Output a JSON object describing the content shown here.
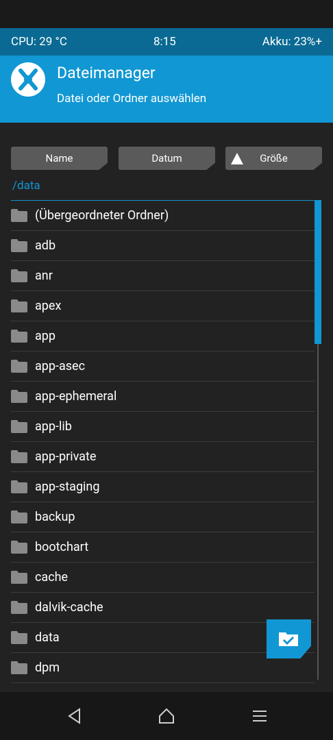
{
  "status": {
    "cpu": "CPU: 29 °C",
    "time": "8:15",
    "battery": "Akku: 23%+"
  },
  "header": {
    "title": "Dateimanager",
    "subtitle": "Datei oder Ordner auswählen"
  },
  "sort": {
    "name": "Name",
    "date": "Datum",
    "size": "Größe",
    "active": "size"
  },
  "path": "/data",
  "files": [
    "(Übergeordneter Ordner)",
    "adb",
    "anr",
    "apex",
    "app",
    "app-asec",
    "app-ephemeral",
    "app-lib",
    "app-private",
    "app-staging",
    "backup",
    "bootchart",
    "cache",
    "dalvik-cache",
    "data",
    "dpm"
  ],
  "colors": {
    "accent": "#1197d3",
    "status_bar": "#0a6a93",
    "background": "#222222"
  },
  "icons": {
    "folder": "folder-icon",
    "logo": "twrp-logo-icon",
    "sort": "sort-ascending-icon",
    "select": "folder-check-icon",
    "back": "back-icon",
    "home": "home-icon",
    "menu": "menu-icon"
  }
}
